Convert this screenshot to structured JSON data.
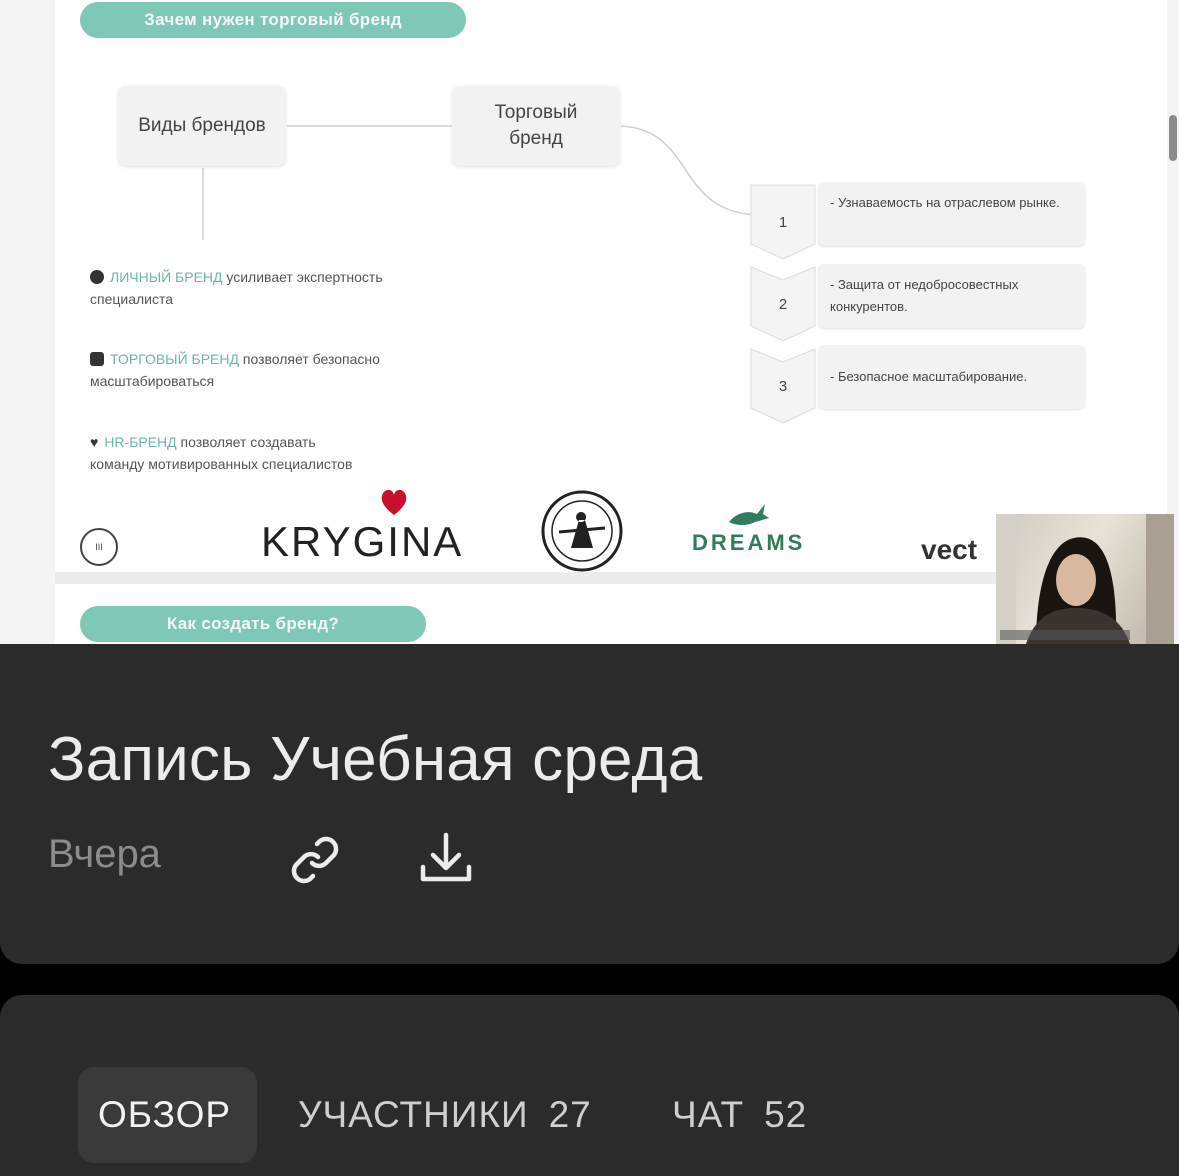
{
  "slide": {
    "header_pill": "Зачем нужен торговый бренд",
    "box_brand_types": "Виды брендов",
    "box_trade_brand_line1": "Торговый",
    "box_trade_brand_line2": "бренд",
    "brand_types": [
      {
        "highlight": "ЛИЧНЫЙ БРЕНД",
        "text": " усиливает экспертность",
        "text2": "специалиста"
      },
      {
        "highlight": "ТОРГОВЫЙ БРЕНД",
        "text": " позволяет безопасно",
        "text2": "масштабироваться"
      },
      {
        "highlight": "HR-БРЕНД",
        "text": " позволяет создавать",
        "text2": "команду мотивированных специалистов"
      }
    ],
    "steps": [
      {
        "num": "1",
        "text": "- Узнаваемость на отраслевом рынке."
      },
      {
        "num": "2",
        "text": "- Защита от недобросовестных конкурентов."
      },
      {
        "num": "3",
        "text": "- Безопасное масштабирование."
      }
    ],
    "logos": {
      "krygina": "KRYGINA",
      "dreams": "DREAMS",
      "vect": "vect"
    },
    "page_badge": "III",
    "footer_pill": "Как создать бренд?"
  },
  "colors": {
    "accent_teal": "#7fc7b7",
    "progress": "#1e88e5",
    "card_bg": "#2b2b2b"
  },
  "player": {
    "progress_fraction": 0.028,
    "buffer_fraction": 0.55
  },
  "recording": {
    "title": "Запись Учебная среда",
    "date": "Вчера",
    "link_icon": "link-icon",
    "download_icon": "download-icon"
  },
  "tabs": [
    {
      "label": "ОБЗОР",
      "count": ""
    },
    {
      "label": "УЧАСТНИКИ",
      "count": "27"
    },
    {
      "label": "ЧАТ",
      "count": "52"
    }
  ]
}
